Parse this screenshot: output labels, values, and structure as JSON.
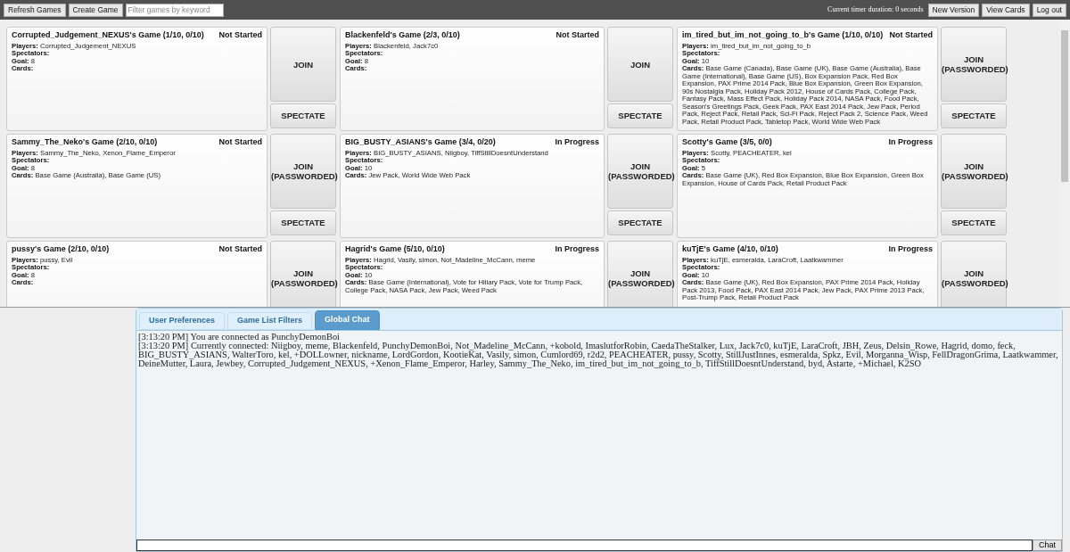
{
  "toolbar": {
    "buttons_left": [
      "Refresh Games",
      "Create Game"
    ],
    "filter": {
      "placeholder": "Filter games by keyword"
    },
    "timer": "Current timer duration: 0 seconds",
    "buttons_right": [
      "New Version",
      "View Cards",
      "Log out"
    ]
  },
  "games": [
    {
      "title": "Corrupted_Judgement_NEXUS's Game (1/10, 0/10)",
      "status": "Not Started",
      "join": "JOIN",
      "spectate": "SPECTATE",
      "details": [
        {
          "label": "Players:",
          "value": "Corrupted_Judgement_NEXUS"
        },
        {
          "label": "Spectators:"
        },
        {
          "label": "Goal:",
          "value": "8"
        },
        {
          "label": "Cards:"
        }
      ]
    },
    {
      "title": "Blackenfeld's Game (2/3, 0/10)",
      "status": "Not Started",
      "join": "JOIN",
      "spectate": "SPECTATE",
      "details": [
        {
          "label": "Players:",
          "value": "Blackenfeld, Jack7c0"
        },
        {
          "label": "Spectators:"
        },
        {
          "label": "Goal:",
          "value": "8"
        },
        {
          "label": "Cards:"
        }
      ]
    },
    {
      "title": "im_tired_but_im_not_going_to_b's Game (1/10, 0/10)",
      "status": "Not Started",
      "join": "JOIN (PASSWORDED)",
      "spectate": "SPECTATE",
      "details": [
        {
          "label": "Players:",
          "value": "im_tired_but_im_not_going_to_b"
        },
        {
          "label": "Spectators:"
        },
        {
          "label": "Goal:",
          "value": "10"
        },
        {
          "label": "Cards:",
          "value": "Base Game (Canada), Base Game (UK), Base Game (Australia), Base Game (International), Base Game (US), Box Expansion Pack, Red Box Expansion, PAX Prime 2014 Pack, Blue Box Expansion, Green Box Expansion, 90s Nostalgia Pack, Holiday Pack 2012, House of Cards Pack, College Pack, Fantasy Pack, Mass Effect Pack, Holiday Pack 2014, NASA Pack, Food Pack, Season's Greetings Pack, Geek Pack, PAX East 2014 Pack, Jew Pack, Period Pack, Reject Pack, Retail Pack, Sci-Fi Pack, Reject Pack 2, Science Pack, Weed Pack, Retail Product Pack, Tabletop Pack, World Wide Web Pack"
        }
      ]
    },
    {
      "title": "Sammy_The_Neko's Game (2/10, 0/10)",
      "status": "Not Started",
      "join": "JOIN (PASSWORDED)",
      "spectate": "SPECTATE",
      "details": [
        {
          "label": "Players:",
          "value": "Sammy_The_Neko, Xenon_Flame_Emperor"
        },
        {
          "label": "Spectators:"
        },
        {
          "label": "Goal:",
          "value": "8"
        },
        {
          "label": "Cards:",
          "value": "Base Game (Australia), Base Game (US)"
        }
      ]
    },
    {
      "title": "BIG_BUSTY_ASIANS's Game (3/4, 0/20)",
      "status": "In Progress",
      "join": "JOIN (PASSWORDED)",
      "spectate": "SPECTATE",
      "details": [
        {
          "label": "Players:",
          "value": "BIG_BUSTY_ASIANS, Niigboy, TiffStillDoesntUnderstand"
        },
        {
          "label": "Spectators:"
        },
        {
          "label": "Goal:",
          "value": "10"
        },
        {
          "label": "Cards:",
          "value": "Jew Pack, World Wide Web Pack"
        }
      ]
    },
    {
      "title": "Scotty's Game (3/5, 0/0)",
      "status": "In Progress",
      "join": "JOIN (PASSWORDED)",
      "spectate": "SPECTATE",
      "details": [
        {
          "label": "Players:",
          "value": "Scotty, PEACHEATER, kel"
        },
        {
          "label": "Spectators:"
        },
        {
          "label": "Goal:",
          "value": "5"
        },
        {
          "label": "Cards:",
          "value": "Base Game (UK), Red Box Expansion, Blue Box Expansion, Green Box Expansion, House of Cards Pack, Retail Product Pack"
        }
      ]
    },
    {
      "title": "pussy's Game (2/10, 0/10)",
      "status": "Not Started",
      "join": "JOIN (PASSWORDED)",
      "details": [
        {
          "label": "Players:",
          "value": "pussy, Evil"
        },
        {
          "label": "Spectators:"
        },
        {
          "label": "Goal:",
          "value": "8"
        },
        {
          "label": "Cards:"
        }
      ]
    },
    {
      "title": "Hagrid's Game (5/10, 0/10)",
      "status": "In Progress",
      "join": "JOIN (PASSWORDED)",
      "details": [
        {
          "label": "Players:",
          "value": "Hagrid, Vasily, simon, Not_Madeline_McCann, meme"
        },
        {
          "label": "Spectators:"
        },
        {
          "label": "Goal:",
          "value": "10"
        },
        {
          "label": "Cards:",
          "value": "Base Game (International), Vote for Hillary Pack, Vote for Trump Pack, College Pack, NASA Pack, Jew Pack, Weed Pack"
        }
      ]
    },
    {
      "title": "kuTjE's Game (4/10, 0/10)",
      "status": "In Progress",
      "join": "JOIN (PASSWORDED)",
      "details": [
        {
          "label": "Players:",
          "value": "kuTjE, esmeralda, LaraCroft, Laatkwammer"
        },
        {
          "label": "Spectators:"
        },
        {
          "label": "Goal:",
          "value": "10"
        },
        {
          "label": "Cards:",
          "value": "Base Game (UK), Red Box Expansion, PAX Prime 2014 Pack, Holiday Pack 2013, Food Pack, PAX East 2014 Pack, Jew Pack, PAX Prime 2013 Pack, Post-Trump Pack, Retail Product Pack"
        }
      ]
    }
  ],
  "tabs": [
    {
      "label": "User Preferences",
      "selected": false
    },
    {
      "label": "Game List Filters",
      "selected": false
    },
    {
      "label": "Global Chat",
      "selected": true
    }
  ],
  "chat_log": [
    "[3:13:20 PM] You are connected as PunchyDemonBoi",
    "[3:13:20 PM] Currently connected: Niigboy, meme, Blackenfeld, PunchyDemonBoi, Not_Madeline_McCann, +kobold, ImaslutforRobin, CaedaTheStalker, Lux, Jack7c0, kuTjE, LaraCroft, JBH, Zeus, Delsin_Rowe, Hagrid, domo, feck, BIG_BUSTY_ASIANS, WalterToro, kel, +DOLLowner, nickname, LordGordon, KootieKat, Vasily, simon, Cumlord69, r2d2, PEACHEATER, pussy, Scotty, StillJustInnes, esmeralda, Spkz, Evil, Morganna_Wisp, FellDragonGrima, Laatkwammer, DeineMutter, Laura, Jewbey, Corrupted_Judgement_NEXUS, +Xenon_Flame_Emperor, Harley, Sammy_The_Neko, im_tired_but_im_not_going_to_b, TiffStillDoesntUnderstand, byd, Astarte, +Michael, K2SO"
  ],
  "chat_button": "Chat"
}
